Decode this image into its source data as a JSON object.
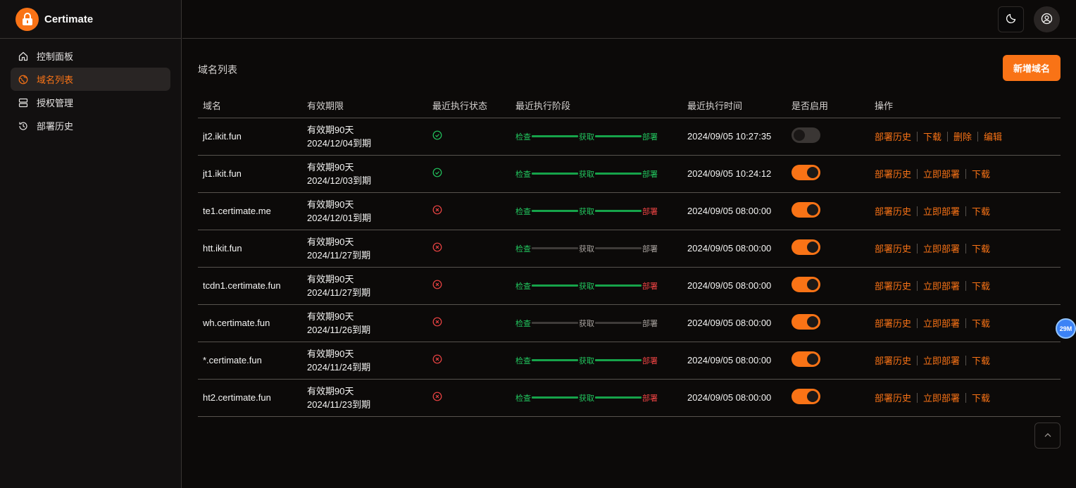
{
  "brand": {
    "name": "Certimate",
    "accent": "#f97316"
  },
  "sidebar": {
    "items": [
      {
        "label": "控制面板",
        "icon": "home-icon",
        "active": false
      },
      {
        "label": "域名列表",
        "icon": "globe-icon",
        "active": true
      },
      {
        "label": "授权管理",
        "icon": "server-icon",
        "active": false
      },
      {
        "label": "部署历史",
        "icon": "history-icon",
        "active": false
      }
    ]
  },
  "topbar": {
    "theme_icon": "moon-icon",
    "user_icon": "user-circle-icon"
  },
  "main": {
    "title": "域名列表",
    "add_button": "新增域名",
    "columns": [
      "域名",
      "有效期限",
      "最近执行状态",
      "最近执行阶段",
      "最近执行时间",
      "是否启用",
      "操作"
    ],
    "stage_labels": [
      "检查",
      "获取",
      "部署"
    ],
    "rows": [
      {
        "domain": "jt2.ikit.fun",
        "validity": "有效期90天",
        "expire": "2024/12/04到期",
        "status": "success",
        "stages": [
          "ok",
          "ok",
          "ok"
        ],
        "bars": [
          "ok",
          "ok"
        ],
        "time": "2024/09/05 10:27:35",
        "enabled": false,
        "actions": [
          "部署历史",
          "下载",
          "删除",
          "编辑"
        ]
      },
      {
        "domain": "jt1.ikit.fun",
        "validity": "有效期90天",
        "expire": "2024/12/03到期",
        "status": "success",
        "stages": [
          "ok",
          "ok",
          "ok"
        ],
        "bars": [
          "ok",
          "ok"
        ],
        "time": "2024/09/05 10:24:12",
        "enabled": true,
        "actions": [
          "部署历史",
          "立即部署",
          "下载"
        ]
      },
      {
        "domain": "te1.certimate.me",
        "validity": "有效期90天",
        "expire": "2024/12/01到期",
        "status": "error",
        "stages": [
          "ok",
          "ok",
          "err"
        ],
        "bars": [
          "ok",
          "ok"
        ],
        "time": "2024/09/05 08:00:00",
        "enabled": true,
        "actions": [
          "部署历史",
          "立即部署",
          "下载"
        ]
      },
      {
        "domain": "htt.ikit.fun",
        "validity": "有效期90天",
        "expire": "2024/11/27到期",
        "status": "error",
        "stages": [
          "ok",
          "pending",
          "pending"
        ],
        "bars": [
          "pending",
          "pending"
        ],
        "time": "2024/09/05 08:00:00",
        "enabled": true,
        "actions": [
          "部署历史",
          "立即部署",
          "下载"
        ]
      },
      {
        "domain": "tcdn1.certimate.fun",
        "validity": "有效期90天",
        "expire": "2024/11/27到期",
        "status": "error",
        "stages": [
          "ok",
          "ok",
          "err"
        ],
        "bars": [
          "ok",
          "ok"
        ],
        "time": "2024/09/05 08:00:00",
        "enabled": true,
        "actions": [
          "部署历史",
          "立即部署",
          "下载"
        ]
      },
      {
        "domain": "wh.certimate.fun",
        "validity": "有效期90天",
        "expire": "2024/11/26到期",
        "status": "error",
        "stages": [
          "ok",
          "pending",
          "pending"
        ],
        "bars": [
          "pending",
          "pending"
        ],
        "time": "2024/09/05 08:00:00",
        "enabled": true,
        "actions": [
          "部署历史",
          "立即部署",
          "下载"
        ]
      },
      {
        "domain": "*.certimate.fun",
        "validity": "有效期90天",
        "expire": "2024/11/24到期",
        "status": "error",
        "stages": [
          "ok",
          "ok",
          "err"
        ],
        "bars": [
          "ok",
          "ok"
        ],
        "time": "2024/09/05 08:00:00",
        "enabled": true,
        "actions": [
          "部署历史",
          "立即部署",
          "下载"
        ]
      },
      {
        "domain": "ht2.certimate.fun",
        "validity": "有效期90天",
        "expire": "2024/11/23到期",
        "status": "error",
        "stages": [
          "ok",
          "ok",
          "err"
        ],
        "bars": [
          "ok",
          "ok"
        ],
        "time": "2024/09/05 08:00:00",
        "enabled": true,
        "actions": [
          "部署历史",
          "立即部署",
          "下载"
        ]
      }
    ]
  },
  "float_badge": "29M",
  "colors": {
    "success": "#22c55e",
    "error": "#ef4444",
    "pending": "#a8a29e",
    "background": "#0c0a09"
  }
}
